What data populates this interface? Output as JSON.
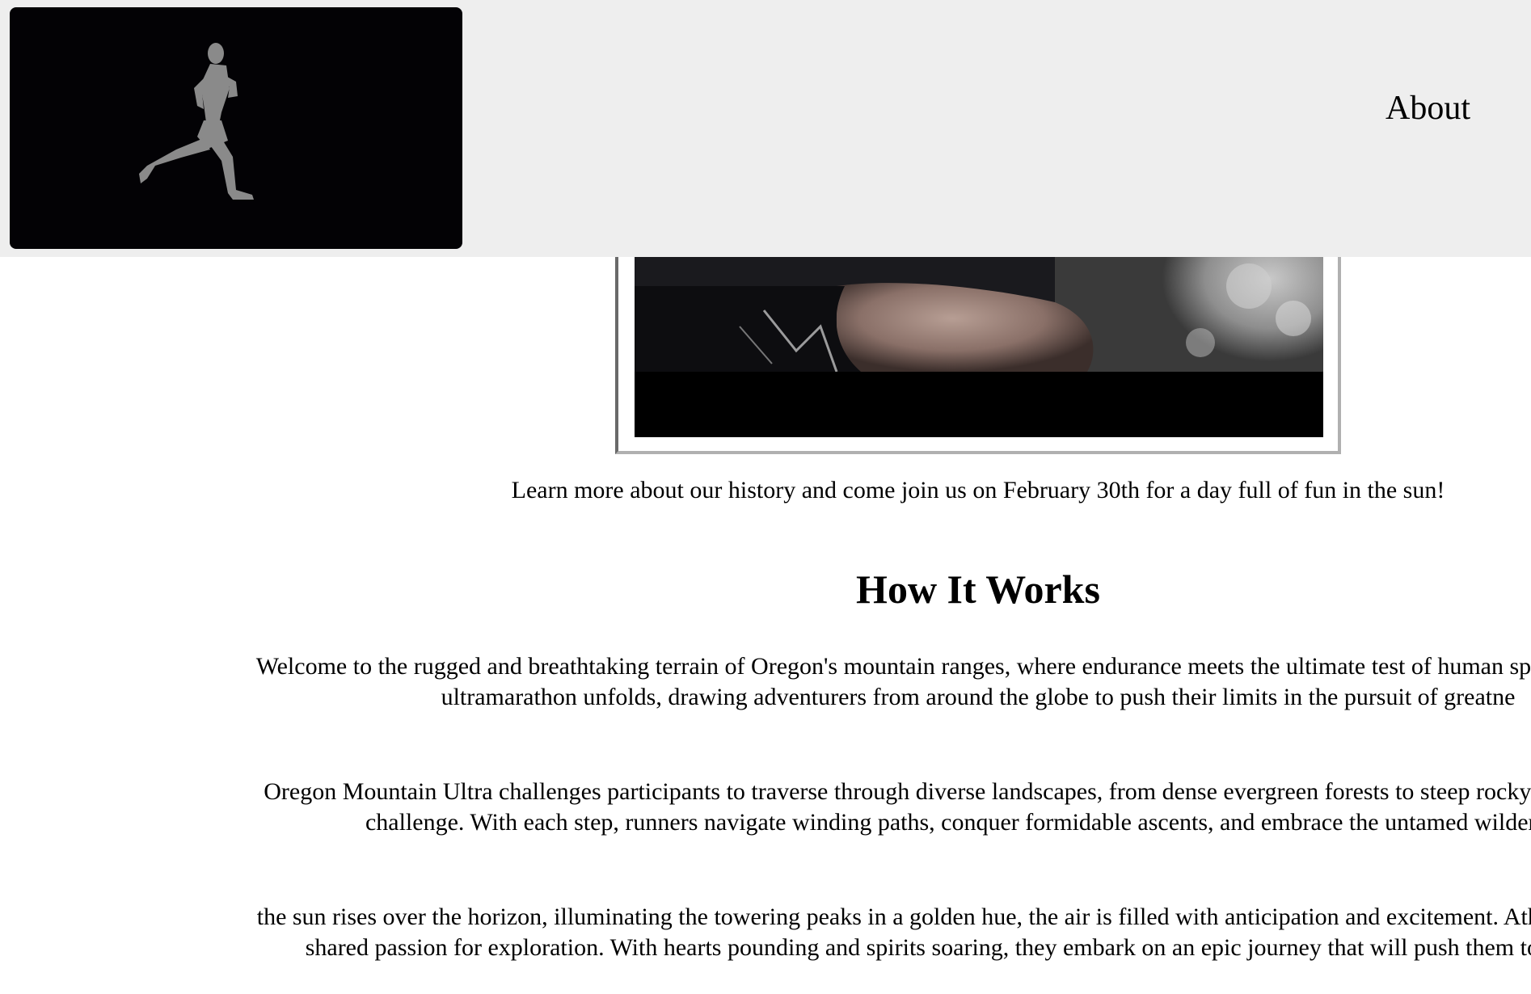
{
  "header": {
    "logo_alt": "runner-logo",
    "nav": {
      "about_label": "About"
    }
  },
  "video": {
    "icon": "video-player"
  },
  "intro": {
    "text": "Learn more about our history and come join us on February 30th for a day full of fun in the sun!"
  },
  "how_it_works": {
    "title": "How It Works",
    "paragraphs": [
      {
        "line1": "Welcome to the rugged and breathtaking terrain of Oregon's mountain ranges, where endurance meets the ultimate test of human spirit. Nestled amid",
        "line2": "ultramarathon unfolds, drawing adventurers from around the globe to push their limits in the pursuit of greatne"
      },
      {
        "line1": "Oregon Mountain Ultra challenges participants to traverse through diverse landscapes, from dense evergreen forests to steep rocky trails, offering a",
        "line2": "challenge. With each step, runners navigate winding paths, conquer formidable ascents, and embrace the untamed wilderness t"
      },
      {
        "line1": "the sun rises over the horizon, illuminating the towering peaks in a golden hue, the air is filled with anticipation and excitement. Athletes gather at th",
        "line2": "shared passion for exploration. With hearts pounding and spirits soaring, they embark on an epic journey that will push them to their limits"
      }
    ]
  },
  "colors": {
    "header_bg": "#eeeeee",
    "logo_bg": "#030205",
    "runner": "#8a8a8a"
  }
}
